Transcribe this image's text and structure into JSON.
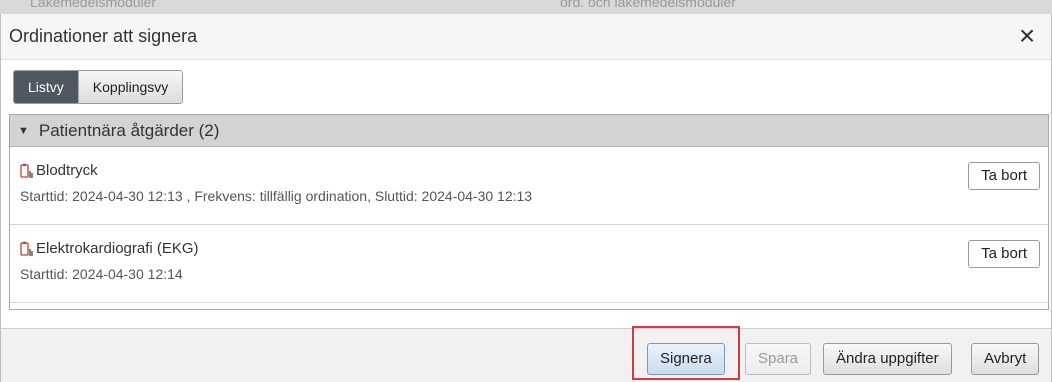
{
  "background": {
    "left_text": "Läkemedelsmoduler",
    "middle_text": "ord. och läkemedelsmoduler"
  },
  "dialog": {
    "title": "Ordinationer att signera",
    "close_glyph": "×"
  },
  "view_toggle": {
    "options": [
      "Listvy",
      "Kopplingsvy"
    ],
    "active": "Listvy"
  },
  "group": {
    "header": "Patientnära åtgärder (2)",
    "items": [
      {
        "name": "Blodtryck",
        "details": "Starttid: 2024-04-30 12:13 , Frekvens: tillfällig ordination, Sluttid: 2024-04-30 12:13",
        "remove_label": "Ta bort",
        "icon": "order-icon"
      },
      {
        "name": "Elektrokardiografi (EKG)",
        "details": "Starttid: 2024-04-30 12:14",
        "remove_label": "Ta bort",
        "icon": "order-icon"
      }
    ]
  },
  "footer": {
    "sign_label": "Signera",
    "save_label": "Spara",
    "change_label": "Ändra uppgifter",
    "cancel_label": "Avbryt"
  },
  "colors": {
    "highlight": "#d23b3b",
    "toggle_active": "#4f5760",
    "icon_red": "#c43b3b"
  }
}
